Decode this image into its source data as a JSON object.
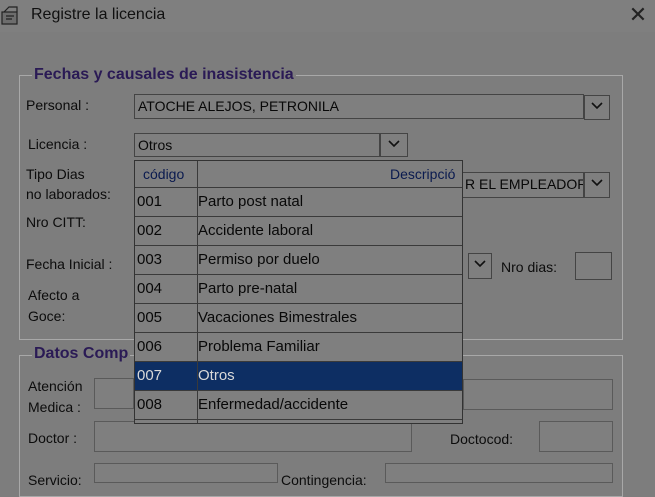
{
  "window": {
    "title": "Registre la licencia",
    "close_icon": "close-icon"
  },
  "section1": {
    "legend": "Fechas y causales de inasistencia"
  },
  "personal": {
    "label": "Personal :",
    "value": "ATOCHE ALEJOS, PETRONILA"
  },
  "licencia": {
    "label": "Licencia :",
    "value": "Otros"
  },
  "tipo_dias": {
    "label_line1": "Tipo Dias",
    "label_line2": "no laborados:",
    "value": "R EL EMPLEADOR"
  },
  "nro_citt": {
    "label": "Nro CITT:"
  },
  "fecha_inicial": {
    "label": "Fecha Inicial :"
  },
  "nro_dias": {
    "label": "Nro dias:",
    "value": ""
  },
  "afecto_goce": {
    "label_line1": "Afecto a",
    "label_line2": "Goce:"
  },
  "section2": {
    "legend": "Datos Comp"
  },
  "atencion_medica": {
    "label_line1": "Atención",
    "label_line2": "Medica :"
  },
  "doctor": {
    "label": "Doctor :"
  },
  "doctocod": {
    "label": "Doctocod:"
  },
  "servicio": {
    "label": "Servicio:"
  },
  "contingencia": {
    "label": "Contingencia:"
  },
  "dropdown": {
    "headers": {
      "codigo": "código",
      "descripcion": "Descripció"
    },
    "selected_index": 6,
    "rows": [
      {
        "code": "001",
        "desc": "Parto post natal"
      },
      {
        "code": "002",
        "desc": "Accidente laboral"
      },
      {
        "code": "003",
        "desc": "Permiso por duelo"
      },
      {
        "code": "004",
        "desc": "Parto pre-natal"
      },
      {
        "code": "005",
        "desc": "Vacaciones Bimestrales"
      },
      {
        "code": "006",
        "desc": "Problema Familiar"
      },
      {
        "code": "007",
        "desc": "Otros"
      },
      {
        "code": "008",
        "desc": "Enfermedad/accidente"
      }
    ]
  },
  "colors": {
    "selection": "#0d2e63",
    "legend": "#2a1a55",
    "overlay_bg": "#7d7d7d"
  }
}
